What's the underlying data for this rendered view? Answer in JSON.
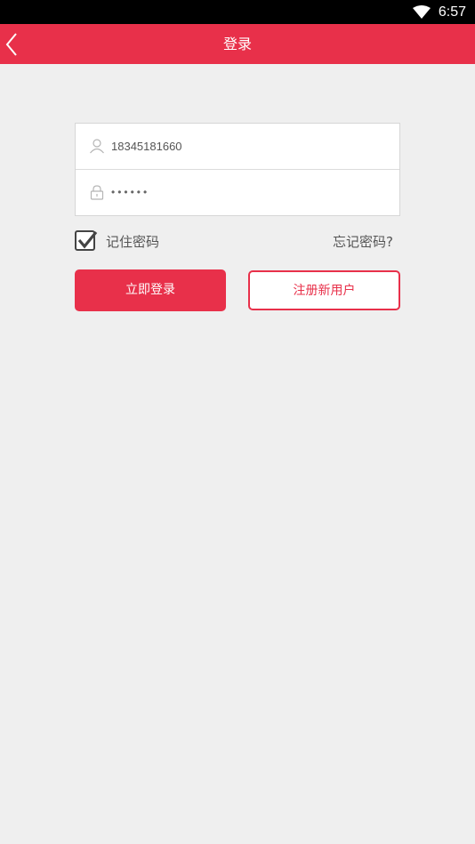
{
  "status_bar": {
    "time": "6:57",
    "wifi_icon": "wifi-icon"
  },
  "header": {
    "title": "登录",
    "back_icon": "back-chevron-icon",
    "background_color": "#e8304a"
  },
  "form": {
    "username": {
      "value": "18345181660",
      "icon": "user-icon"
    },
    "password": {
      "value": "••••••",
      "icon": "lock-icon"
    }
  },
  "options": {
    "remember_label": "记住密码",
    "remember_checked": true,
    "forgot_label": "忘记密码?"
  },
  "buttons": {
    "login_label": "立即登录",
    "register_label": "注册新用户"
  },
  "colors": {
    "accent": "#e8304a",
    "background": "#efefef"
  }
}
